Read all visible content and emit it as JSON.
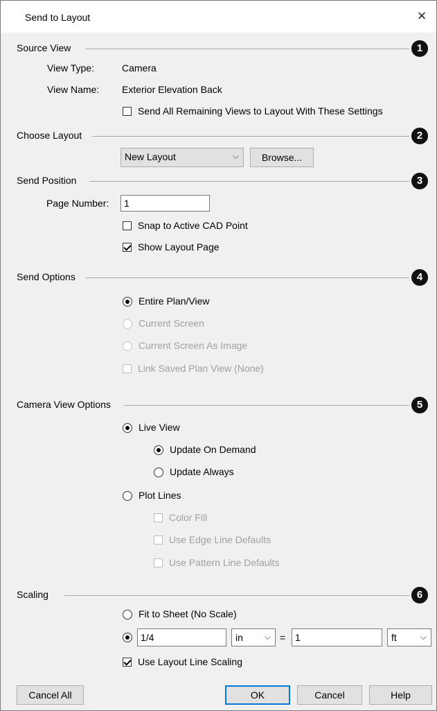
{
  "dialog": {
    "title": "Send to Layout",
    "close_glyph": "×"
  },
  "sections": {
    "source_view": {
      "title": "Source View",
      "badge": "1",
      "view_type_label": "View Type:",
      "view_type_value": "Camera",
      "view_name_label": "View Name:",
      "view_name_value": "Exterior Elevation Back",
      "send_all_label": "Send All Remaining Views to Layout With These Settings",
      "send_all_checked": false
    },
    "choose_layout": {
      "title": "Choose Layout",
      "badge": "2",
      "layout_value": "New Layout",
      "browse_label": "Browse..."
    },
    "send_position": {
      "title": "Send Position",
      "badge": "3",
      "page_number_label": "Page Number:",
      "page_number_value": "1",
      "snap_label": "Snap to Active CAD Point",
      "snap_checked": false,
      "show_page_label": "Show Layout Page",
      "show_page_checked": true
    },
    "send_options": {
      "title": "Send Options",
      "badge": "4",
      "entire_label": "Entire Plan/View",
      "current_screen_label": "Current Screen",
      "current_image_label": "Current Screen As Image",
      "link_saved_label": "Link Saved Plan View (None)",
      "selected": "Entire Plan/View"
    },
    "camera_options": {
      "title": "Camera View Options",
      "badge": "5",
      "live_view_label": "Live View",
      "update_demand_label": "Update On Demand",
      "update_always_label": "Update Always",
      "plot_lines_label": "Plot Lines",
      "color_fill_label": "Color Fill",
      "edge_defaults_label": "Use Edge Line Defaults",
      "pattern_defaults_label": "Use Pattern Line Defaults"
    },
    "scaling": {
      "title": "Scaling",
      "badge": "6",
      "fit_label": "Fit to Sheet (No Scale)",
      "scale_value": "1/4",
      "scale_unit": "in",
      "equals": "=",
      "model_value": "1",
      "model_unit": "ft",
      "line_scaling_label": "Use Layout Line Scaling",
      "line_scaling_checked": true
    }
  },
  "buttons": {
    "cancel_all": "Cancel All",
    "ok": "OK",
    "cancel": "Cancel",
    "help": "Help"
  },
  "icons": {
    "chevron": "⌵"
  }
}
